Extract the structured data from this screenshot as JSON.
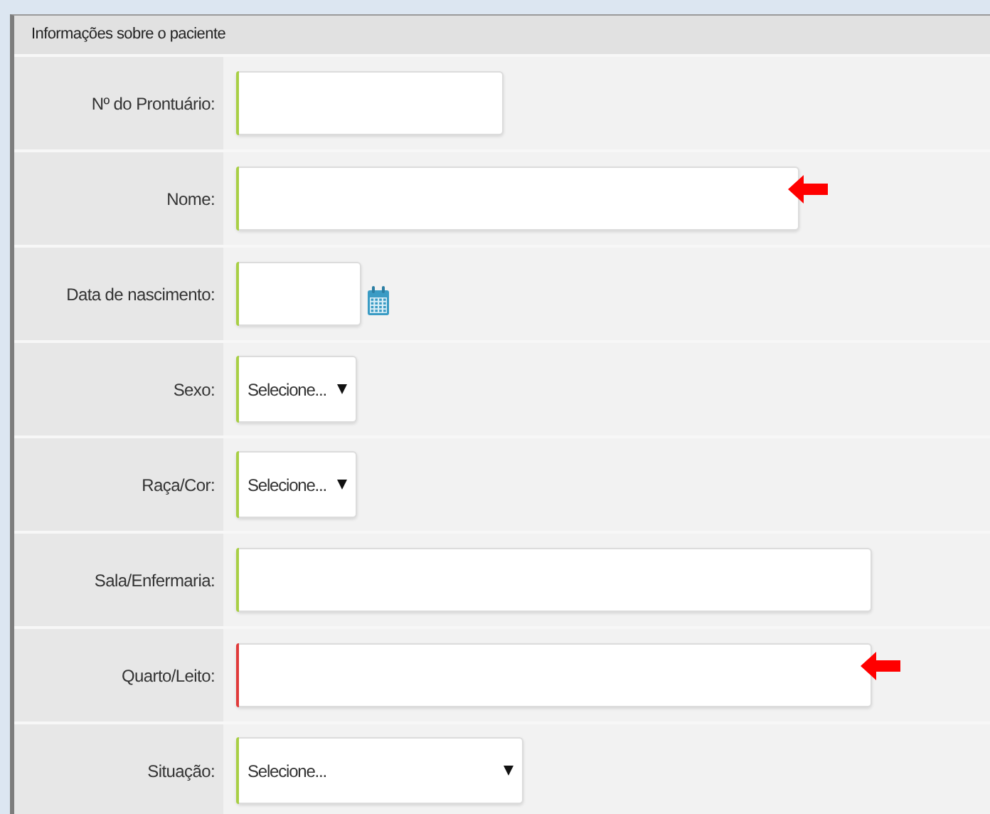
{
  "section": {
    "title": "Informações sobre o paciente"
  },
  "fields": [
    {
      "label": "Nº do Prontuário:",
      "kind": "text",
      "color": "#a8cf45",
      "marked": false
    },
    {
      "label": "Nome:",
      "kind": "text",
      "color": "#a8cf45",
      "marked": true
    },
    {
      "label": "Data de nascimento:",
      "kind": "date",
      "color": "#a8cf45",
      "marked": false
    },
    {
      "label": "Sexo:",
      "kind": "select",
      "value": "Selecione...",
      "color": "#a8cf45",
      "marked": false
    },
    {
      "label": "Raça/Cor:",
      "kind": "select",
      "value": "Selecione...",
      "color": "#a8cf45",
      "marked": false
    },
    {
      "label": "Sala/Enfermaria:",
      "kind": "text",
      "color": "#a8cf45",
      "marked": false
    },
    {
      "label": "Quarto/Leito:",
      "kind": "text",
      "color": "#e03a3a",
      "marked": true
    },
    {
      "label": "Situação:",
      "kind": "select",
      "value": "Selecione...",
      "color": "#a8cf45",
      "marked": false
    }
  ]
}
